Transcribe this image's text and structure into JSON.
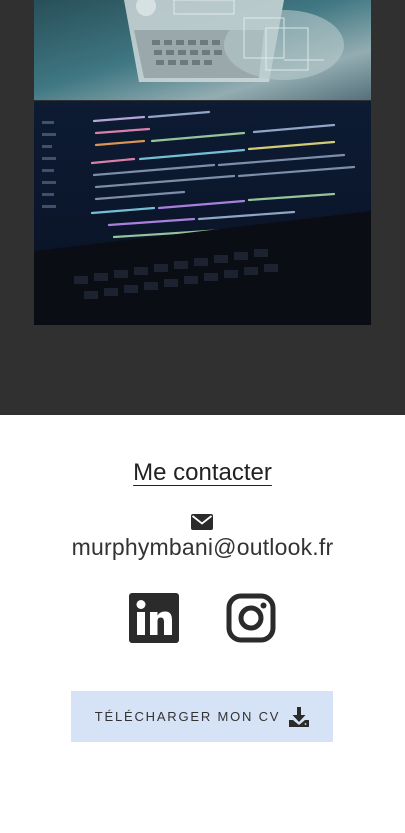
{
  "contact": {
    "title": "Me contacter",
    "email": "murphymbani@outlook.fr"
  },
  "icons": {
    "mail": "envelope-icon",
    "linkedin": "linkedin-icon",
    "instagram": "instagram-icon",
    "download": "download-icon"
  },
  "cv_button": {
    "label": "TÉLÉCHARGER MON CV"
  },
  "colors": {
    "dark_background": "#303030",
    "button_background": "#d6e3f7",
    "text": "#222222"
  }
}
